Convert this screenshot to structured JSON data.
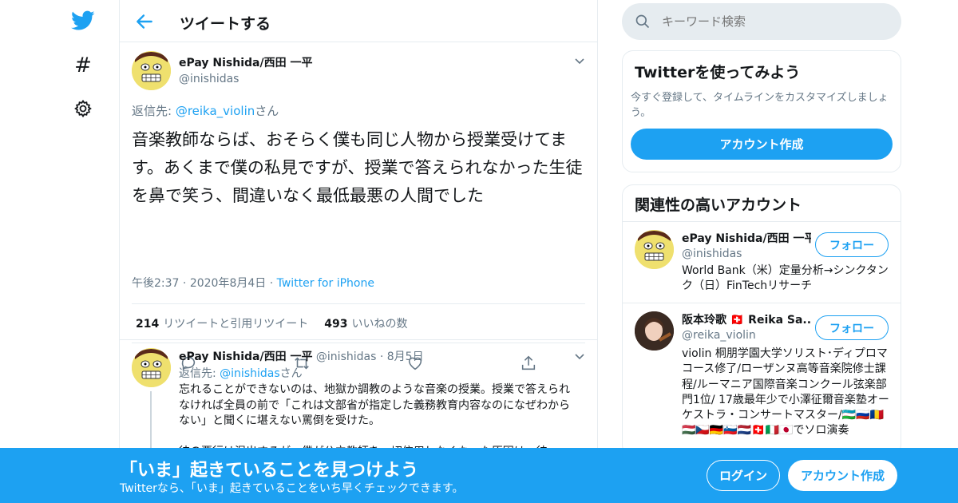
{
  "nav": {
    "logo": "twitter-bird-icon",
    "explore": "hashtag-icon",
    "settings": "gear-icon"
  },
  "header": {
    "title": "ツイートする",
    "back_icon": "back-arrow-icon"
  },
  "tweet": {
    "name": "ePay Nishida/西田 一平",
    "handle": "@inishidas",
    "reply_prefix": "返信先: ",
    "reply_to": "@reika_violin",
    "reply_suffix": "さん",
    "text": "音楽教師ならば、おそらく僕も同じ人物から授業受けてます。あくまで僕の私見ですが、授業で答えられなかった生徒を鼻で笑う、間違いなく最低最悪の人間でした",
    "time": "午後2:37",
    "date": "2020年8月4日",
    "source": "Twitter for iPhone",
    "sep": "·",
    "retweets_count": "214",
    "retweets_label": "リツイートと引用リツイート",
    "likes_count": "493",
    "likes_label": "いいねの数"
  },
  "reply": {
    "name": "ePay Nishida/西田 一平",
    "handle": "@inishidas",
    "sep": "·",
    "date": "8月5日",
    "reply_prefix": "返信先: ",
    "reply_to": "@inishidas",
    "reply_suffix": "さん",
    "text1": "忘れることができないのは、地獄か調教のような音楽の授業。授業で答えられなければ全員の前で「これは文部省が指定した義務教育内容なのになぜわからない」と聞くに堪えない罵倒を受けた。",
    "text2": "彼の悪行は湿出するが、僕が公立教師を一切信用しなくなった原因は、彼"
  },
  "search": {
    "placeholder": "キーワード検索"
  },
  "signup_panel": {
    "title": "Twitterを使ってみよう",
    "desc": "今すぐ登録して、タイムラインをカスタマイズしましょう。",
    "button": "アカウント作成"
  },
  "related": {
    "title": "関連性の高いアカウント",
    "accounts": [
      {
        "name": "ePay Nishida/西田 一平",
        "handle": "@inishidas",
        "bio": "World Bank（米）定量分析→シンクタンク（日）FinTechリサーチ",
        "button": "フォロー"
      },
      {
        "name": "阪本玲歌 🇨🇭 Reika Sa...",
        "handle": "@reika_violin",
        "bio": "violin 桐朋学園大学ソリスト･ディプロマコース修了/ローザンヌ高等音楽院修士課程/ルーマニア国際音楽コンクール弦楽部門1位/ 17歳最年少で小澤征爾音楽塾オーケストラ・コンサートマスター/🇺🇿🇷🇺🇷🇴🇭🇺🇨🇿🇩🇪🇸🇮🇳🇱🇨🇭🇮🇹🇯🇵でソロ演奏",
        "button": "フォロー"
      }
    ]
  },
  "banner": {
    "title": "「いま」起きていることを見つけよう",
    "subtitle": "Twitterなら、「いま」起きていることをいち早くチェックできます。",
    "login": "ログイン",
    "signup": "アカウント作成"
  },
  "colors": {
    "accent": "#1da1f2",
    "border": "#e6ecf0",
    "muted": "#657786"
  }
}
